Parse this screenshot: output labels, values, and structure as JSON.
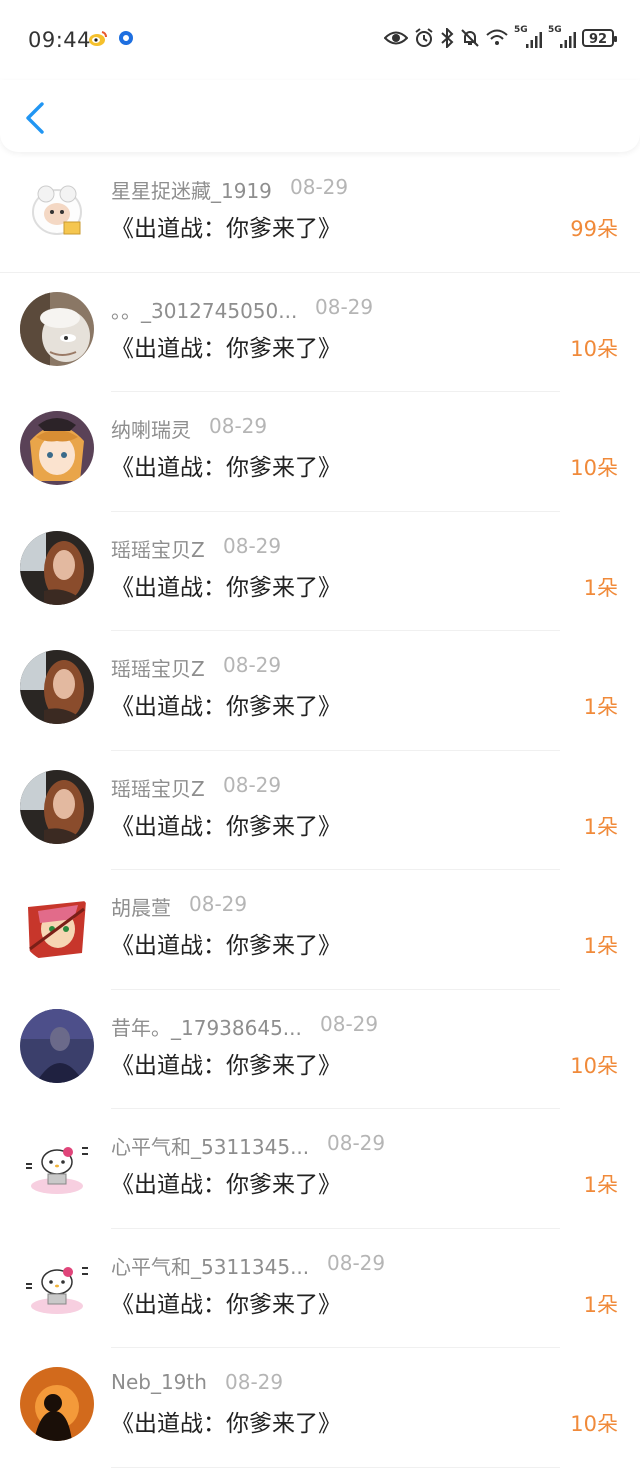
{
  "status_bar": {
    "time": "09:44",
    "battery": "92",
    "net_label_1": "5G",
    "net_label_2": "5G"
  },
  "nav": {
    "back_icon": "chevron-left-icon"
  },
  "colors": {
    "accent": "#2196F3",
    "count": "#F08A3A"
  },
  "records": [
    {
      "name": "星星捉迷藏_1919",
      "date": "08-29",
      "gift": "《出道战：你爹来了》",
      "count": "99朵",
      "avatar": "cartoon-sheep"
    },
    {
      "name": "。。_3012745050...",
      "date": "08-29",
      "gift": "《出道战：你爹来了》",
      "count": "10朵",
      "avatar": "cartoon-goat"
    },
    {
      "name": "纳喇瑞灵",
      "date": "08-29",
      "gift": "《出道战：你爹来了》",
      "count": "10朵",
      "avatar": "anime-girl"
    },
    {
      "name": "瑶瑶宝贝Z",
      "date": "08-29",
      "gift": "《出道战：你爹来了》",
      "count": "1朵",
      "avatar": "photo-woman"
    },
    {
      "name": "瑶瑶宝贝Z",
      "date": "08-29",
      "gift": "《出道战：你爹来了》",
      "count": "1朵",
      "avatar": "photo-woman"
    },
    {
      "name": "瑶瑶宝贝Z",
      "date": "08-29",
      "gift": "《出道战：你爹来了》",
      "count": "1朵",
      "avatar": "photo-woman"
    },
    {
      "name": "胡晨萱",
      "date": "08-29",
      "gift": "《出道战：你爹来了》",
      "count": "1朵",
      "avatar": "anime-ninja"
    },
    {
      "name": "昔年。_17938645...",
      "date": "08-29",
      "gift": "《出道战：你爹来了》",
      "count": "10朵",
      "avatar": "photo-man"
    },
    {
      "name": "心平气和_5311345...",
      "date": "08-29",
      "gift": "《出道战：你爹来了》",
      "count": "1朵",
      "avatar": "hello-kitty"
    },
    {
      "name": "心平气和_5311345...",
      "date": "08-29",
      "gift": "《出道战：你爹来了》",
      "count": "1朵",
      "avatar": "hello-kitty"
    },
    {
      "name": "Neb_19th",
      "date": "08-29",
      "gift": "《出道战：你爹来了》",
      "count": "10朵",
      "avatar": "silhouette-sunset"
    }
  ]
}
